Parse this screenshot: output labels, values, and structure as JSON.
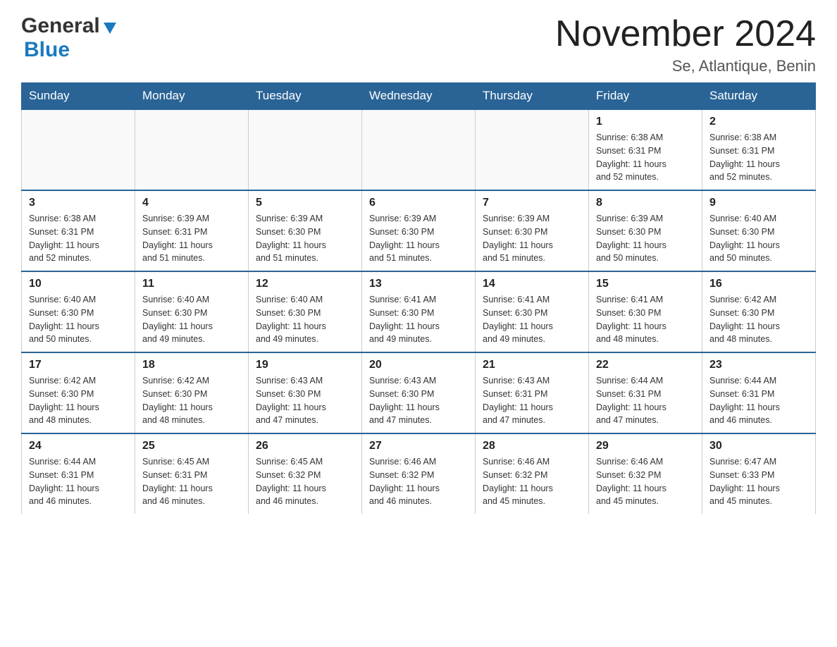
{
  "header": {
    "logo_general": "General",
    "logo_blue": "Blue",
    "month_year": "November 2024",
    "location": "Se, Atlantique, Benin"
  },
  "weekdays": [
    "Sunday",
    "Monday",
    "Tuesday",
    "Wednesday",
    "Thursday",
    "Friday",
    "Saturday"
  ],
  "weeks": [
    [
      {
        "day": "",
        "info": ""
      },
      {
        "day": "",
        "info": ""
      },
      {
        "day": "",
        "info": ""
      },
      {
        "day": "",
        "info": ""
      },
      {
        "day": "",
        "info": ""
      },
      {
        "day": "1",
        "info": "Sunrise: 6:38 AM\nSunset: 6:31 PM\nDaylight: 11 hours\nand 52 minutes."
      },
      {
        "day": "2",
        "info": "Sunrise: 6:38 AM\nSunset: 6:31 PM\nDaylight: 11 hours\nand 52 minutes."
      }
    ],
    [
      {
        "day": "3",
        "info": "Sunrise: 6:38 AM\nSunset: 6:31 PM\nDaylight: 11 hours\nand 52 minutes."
      },
      {
        "day": "4",
        "info": "Sunrise: 6:39 AM\nSunset: 6:31 PM\nDaylight: 11 hours\nand 51 minutes."
      },
      {
        "day": "5",
        "info": "Sunrise: 6:39 AM\nSunset: 6:30 PM\nDaylight: 11 hours\nand 51 minutes."
      },
      {
        "day": "6",
        "info": "Sunrise: 6:39 AM\nSunset: 6:30 PM\nDaylight: 11 hours\nand 51 minutes."
      },
      {
        "day": "7",
        "info": "Sunrise: 6:39 AM\nSunset: 6:30 PM\nDaylight: 11 hours\nand 51 minutes."
      },
      {
        "day": "8",
        "info": "Sunrise: 6:39 AM\nSunset: 6:30 PM\nDaylight: 11 hours\nand 50 minutes."
      },
      {
        "day": "9",
        "info": "Sunrise: 6:40 AM\nSunset: 6:30 PM\nDaylight: 11 hours\nand 50 minutes."
      }
    ],
    [
      {
        "day": "10",
        "info": "Sunrise: 6:40 AM\nSunset: 6:30 PM\nDaylight: 11 hours\nand 50 minutes."
      },
      {
        "day": "11",
        "info": "Sunrise: 6:40 AM\nSunset: 6:30 PM\nDaylight: 11 hours\nand 49 minutes."
      },
      {
        "day": "12",
        "info": "Sunrise: 6:40 AM\nSunset: 6:30 PM\nDaylight: 11 hours\nand 49 minutes."
      },
      {
        "day": "13",
        "info": "Sunrise: 6:41 AM\nSunset: 6:30 PM\nDaylight: 11 hours\nand 49 minutes."
      },
      {
        "day": "14",
        "info": "Sunrise: 6:41 AM\nSunset: 6:30 PM\nDaylight: 11 hours\nand 49 minutes."
      },
      {
        "day": "15",
        "info": "Sunrise: 6:41 AM\nSunset: 6:30 PM\nDaylight: 11 hours\nand 48 minutes."
      },
      {
        "day": "16",
        "info": "Sunrise: 6:42 AM\nSunset: 6:30 PM\nDaylight: 11 hours\nand 48 minutes."
      }
    ],
    [
      {
        "day": "17",
        "info": "Sunrise: 6:42 AM\nSunset: 6:30 PM\nDaylight: 11 hours\nand 48 minutes."
      },
      {
        "day": "18",
        "info": "Sunrise: 6:42 AM\nSunset: 6:30 PM\nDaylight: 11 hours\nand 48 minutes."
      },
      {
        "day": "19",
        "info": "Sunrise: 6:43 AM\nSunset: 6:30 PM\nDaylight: 11 hours\nand 47 minutes."
      },
      {
        "day": "20",
        "info": "Sunrise: 6:43 AM\nSunset: 6:30 PM\nDaylight: 11 hours\nand 47 minutes."
      },
      {
        "day": "21",
        "info": "Sunrise: 6:43 AM\nSunset: 6:31 PM\nDaylight: 11 hours\nand 47 minutes."
      },
      {
        "day": "22",
        "info": "Sunrise: 6:44 AM\nSunset: 6:31 PM\nDaylight: 11 hours\nand 47 minutes."
      },
      {
        "day": "23",
        "info": "Sunrise: 6:44 AM\nSunset: 6:31 PM\nDaylight: 11 hours\nand 46 minutes."
      }
    ],
    [
      {
        "day": "24",
        "info": "Sunrise: 6:44 AM\nSunset: 6:31 PM\nDaylight: 11 hours\nand 46 minutes."
      },
      {
        "day": "25",
        "info": "Sunrise: 6:45 AM\nSunset: 6:31 PM\nDaylight: 11 hours\nand 46 minutes."
      },
      {
        "day": "26",
        "info": "Sunrise: 6:45 AM\nSunset: 6:32 PM\nDaylight: 11 hours\nand 46 minutes."
      },
      {
        "day": "27",
        "info": "Sunrise: 6:46 AM\nSunset: 6:32 PM\nDaylight: 11 hours\nand 46 minutes."
      },
      {
        "day": "28",
        "info": "Sunrise: 6:46 AM\nSunset: 6:32 PM\nDaylight: 11 hours\nand 45 minutes."
      },
      {
        "day": "29",
        "info": "Sunrise: 6:46 AM\nSunset: 6:32 PM\nDaylight: 11 hours\nand 45 minutes."
      },
      {
        "day": "30",
        "info": "Sunrise: 6:47 AM\nSunset: 6:33 PM\nDaylight: 11 hours\nand 45 minutes."
      }
    ]
  ]
}
